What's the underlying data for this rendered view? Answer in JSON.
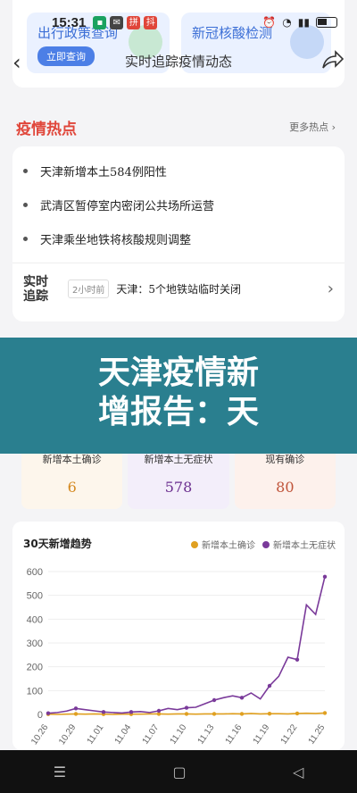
{
  "status": {
    "time": "15:31",
    "battery": "56"
  },
  "nav": {
    "title": "实时追踪疫情动态"
  },
  "promo": [
    {
      "title": "出行政策查询",
      "button": "立即查询"
    },
    {
      "title": "新冠核酸检测"
    }
  ],
  "hot": {
    "title": "疫情热点",
    "more": "更多热点",
    "items": [
      "天津新增本土584例阳性",
      "武清区暂停室内密闭公共场所运营",
      "天津乘坐地铁将核酸规则调整"
    ],
    "realtime": {
      "logo_line1": "实时",
      "logo_line2": "追踪",
      "tag": "2小时前",
      "text": "天津：5个地铁站临时关闭"
    }
  },
  "overlay": {
    "line1": "天津疫情新",
    "line2": "增报告：天"
  },
  "stats": [
    {
      "label": "新增本土确诊",
      "value": "6"
    },
    {
      "label": "新增本土无症状",
      "value": "578"
    },
    {
      "label": "现有确诊",
      "value": "80"
    }
  ],
  "chart_data": {
    "type": "line",
    "title": "30天新增趋势",
    "x": [
      "10.26",
      "10.27",
      "10.28",
      "10.29",
      "10.30",
      "10.31",
      "11.01",
      "11.02",
      "11.03",
      "11.04",
      "11.05",
      "11.06",
      "11.07",
      "11.08",
      "11.09",
      "11.10",
      "11.11",
      "11.12",
      "11.13",
      "11.14",
      "11.15",
      "11.16",
      "11.17",
      "11.18",
      "11.19",
      "11.20",
      "11.21",
      "11.22",
      "11.23",
      "11.24",
      "11.25"
    ],
    "xticks": [
      "10.26",
      "10.29",
      "11.01",
      "11.04",
      "11.07",
      "11.10",
      "11.13",
      "11.16",
      "11.19",
      "11.22",
      "11.25"
    ],
    "ylim": [
      0,
      600
    ],
    "yticks": [
      0,
      100,
      200,
      300,
      400,
      500,
      600
    ],
    "colors": {
      "confirmed": "#e0a020",
      "asymptomatic": "#7a3a9a"
    },
    "series": [
      {
        "name": "新增本土确诊",
        "values": [
          1,
          0,
          1,
          2,
          1,
          2,
          1,
          0,
          1,
          1,
          1,
          2,
          2,
          1,
          2,
          2,
          1,
          2,
          2,
          2,
          3,
          2,
          4,
          2,
          3,
          3,
          2,
          4,
          5,
          4,
          6
        ]
      },
      {
        "name": "新增本土无症状",
        "values": [
          5,
          8,
          14,
          25,
          20,
          15,
          10,
          8,
          6,
          10,
          12,
          8,
          15,
          25,
          20,
          28,
          30,
          45,
          60,
          70,
          78,
          70,
          90,
          65,
          120,
          160,
          240,
          230,
          460,
          420,
          578
        ]
      }
    ]
  }
}
